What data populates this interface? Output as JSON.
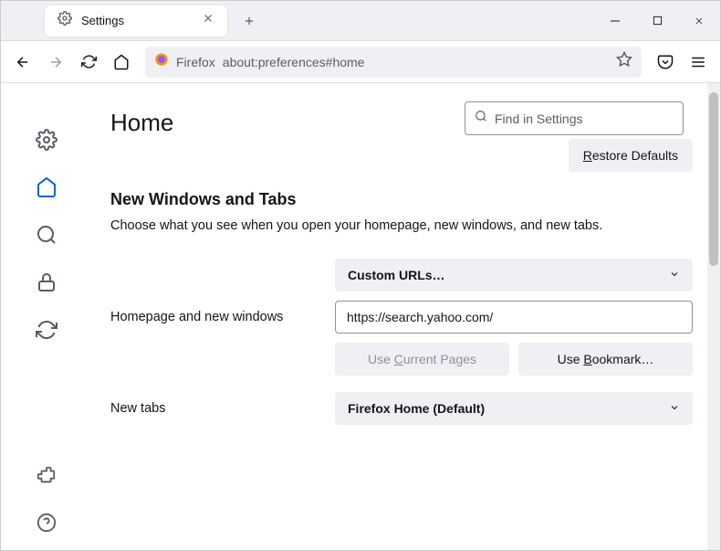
{
  "window": {
    "tab_title": "Settings"
  },
  "toolbar": {
    "url_identity": "Firefox",
    "url_path": "about:preferences#home"
  },
  "search": {
    "placeholder": "Find in Settings"
  },
  "page": {
    "title": "Home",
    "restore_label": "Restore Defaults",
    "section_title": "New Windows and Tabs",
    "section_desc": "Choose what you see when you open your homepage, new windows, and new tabs."
  },
  "homepage": {
    "label": "Homepage and new windows",
    "dropdown": "Custom URLs…",
    "url_value": "https://search.yahoo.com/",
    "use_current": "Use Current Pages",
    "use_bookmark": "Use Bookmark…"
  },
  "newtabs": {
    "label": "New tabs",
    "dropdown": "Firefox Home (Default)"
  }
}
